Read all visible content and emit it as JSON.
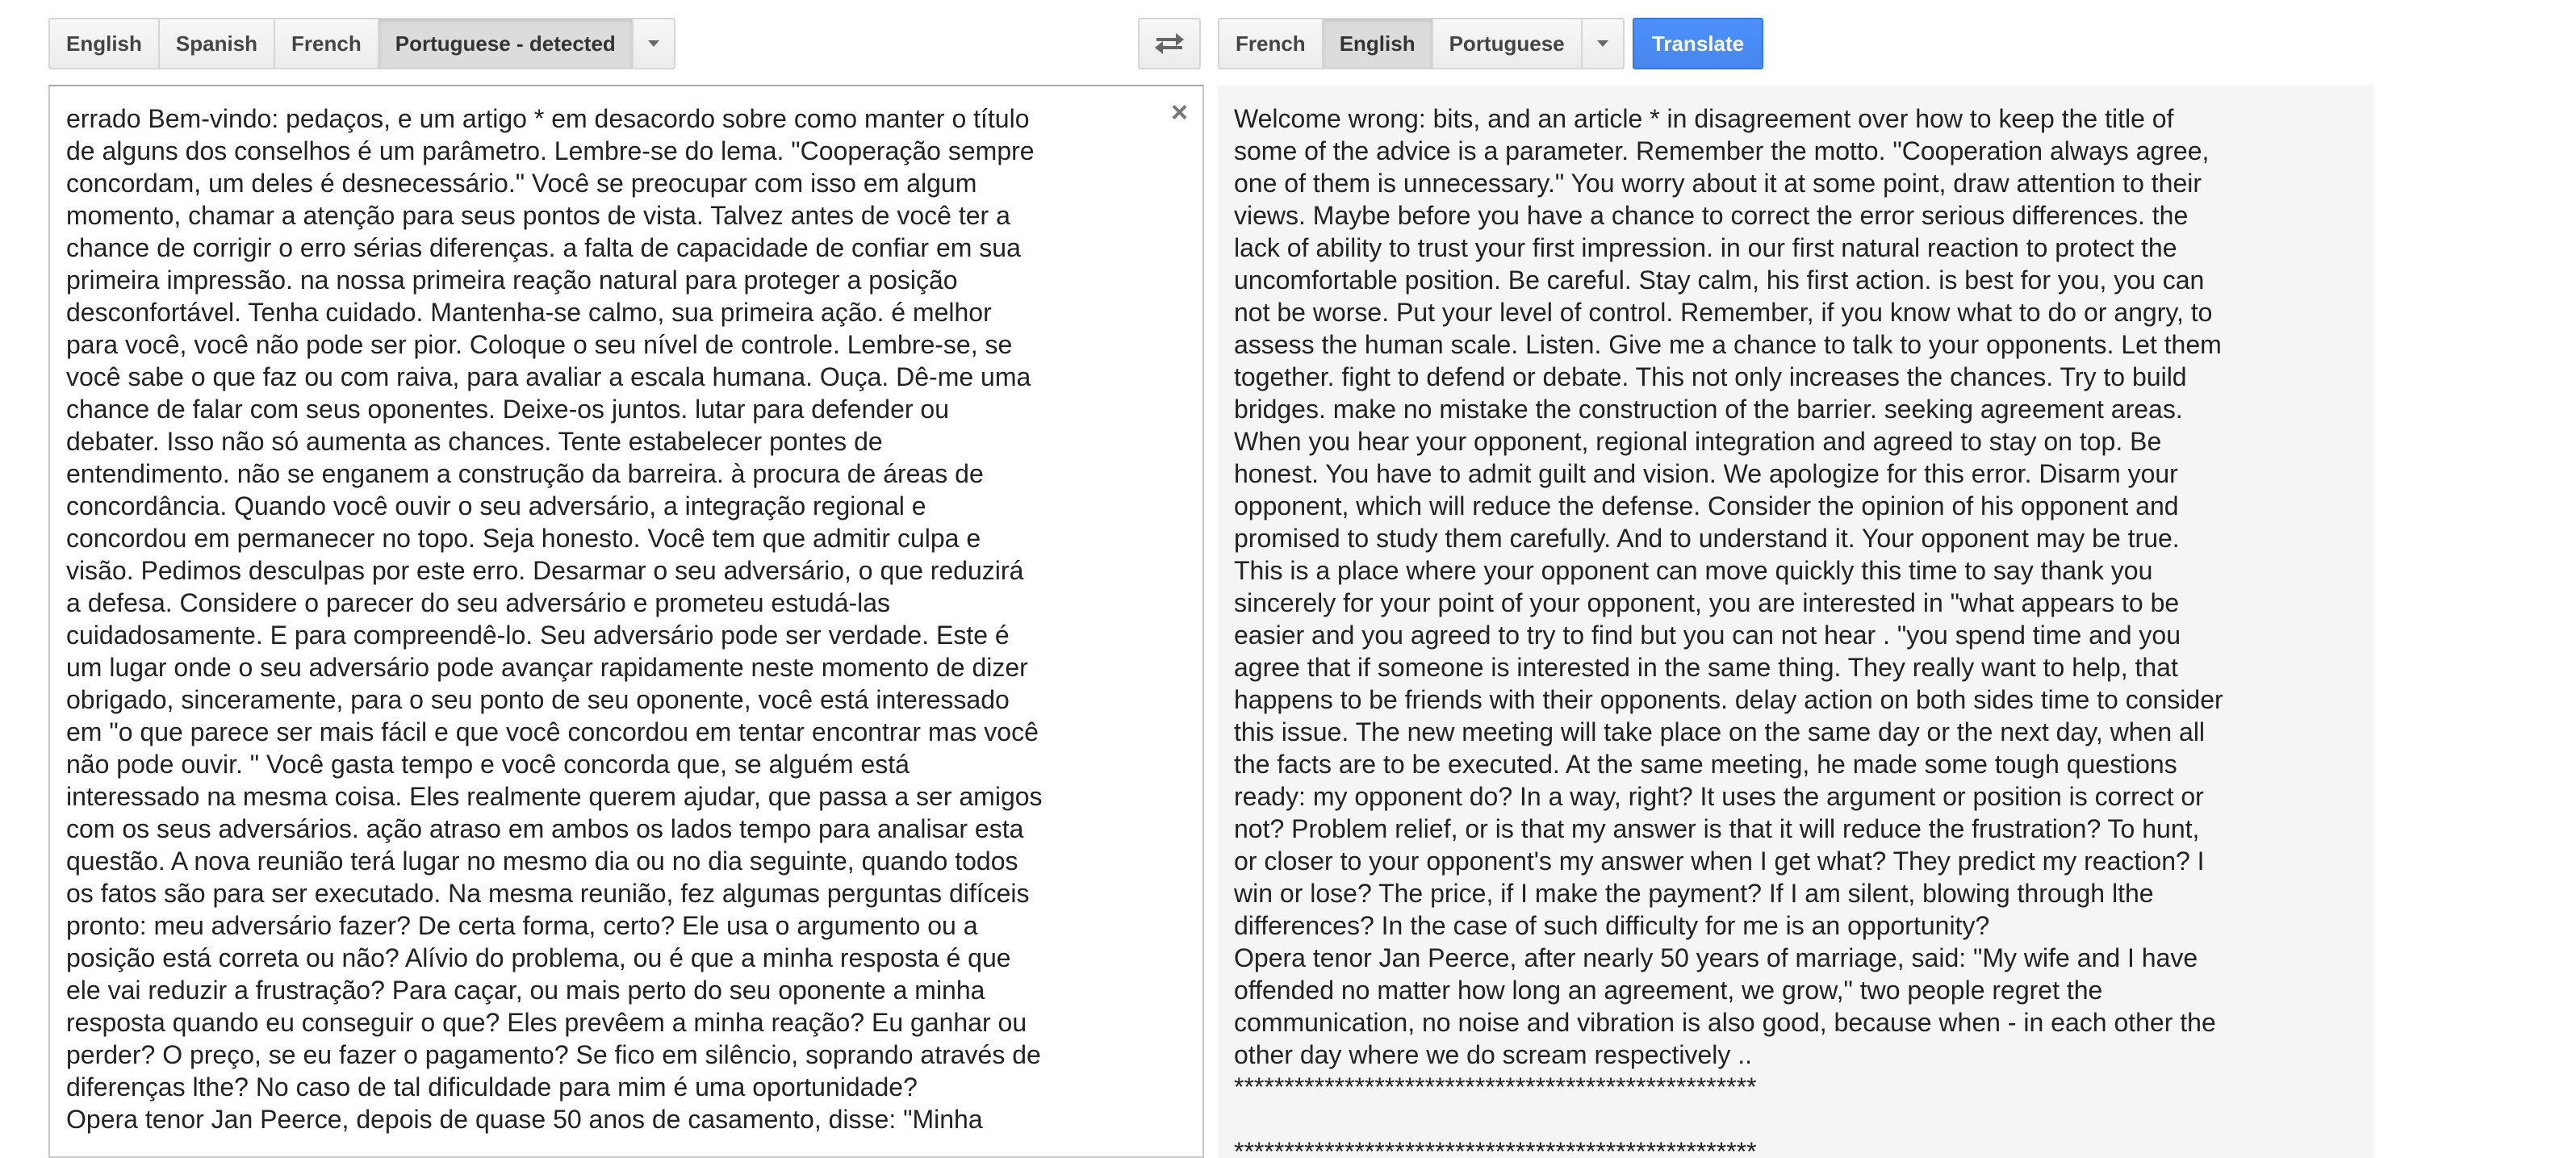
{
  "source_languages": {
    "buttons": [
      "English",
      "Spanish",
      "French",
      "Portuguese - detected"
    ],
    "selected_index": 3
  },
  "target_languages": {
    "buttons": [
      "French",
      "English",
      "Portuguese"
    ],
    "selected_index": 1
  },
  "icons": {
    "swap": "swap-languages-icon",
    "dropdown": "chevron-down-icon",
    "clear": "close-icon"
  },
  "translate_button": {
    "label": "Translate",
    "color": "#4d90fe"
  },
  "clear_glyph": "×",
  "source_text": "errado Bem-vindo: pedaços, e um artigo * em desacordo sobre como manter o título\nde alguns dos conselhos é um parâmetro. Lembre-se do lema. \"Cooperação sempre\nconcordam, um deles é desnecessário.\" Você se preocupar com isso em algum\nmomento, chamar a atenção para seus pontos de vista. Talvez antes de você ter a\nchance de corrigir o erro sérias diferenças. a falta de capacidade de confiar em sua\nprimeira impressão. na nossa primeira reação natural para proteger a posição\ndesconfortável. Tenha cuidado. Mantenha-se calmo, sua primeira ação. é melhor\npara você, você não pode ser pior. Coloque o seu nível de controle. Lembre-se, se\nvocê sabe o que faz ou com raiva, para avaliar a escala humana. Ouça. Dê-me uma\nchance de falar com seus oponentes. Deixe-os juntos. lutar para defender ou\ndebater. Isso não só aumenta as chances. Tente estabelecer pontes de\nentendimento. não se enganem a construção da barreira. à procura de áreas de\nconcordância. Quando você ouvir o seu adversário, a integração regional e\nconcordou em permanecer no topo. Seja honesto. Você tem que admitir culpa e\nvisão. Pedimos desculpas por este erro. Desarmar o seu adversário, o que reduzirá\na defesa. Considere o parecer do seu adversário e prometeu estudá-las\ncuidadosamente. E para compreendê-lo. Seu adversário pode ser verdade. Este é\num lugar onde o seu adversário pode avançar rapidamente neste momento de dizer\nobrigado, sinceramente, para o seu ponto de seu oponente, você está interessado\nem \"o que parece ser mais fácil e que você concordou em tentar encontrar mas você\nnão pode ouvir. \" Você gasta tempo e você concorda que, se alguém está\ninteressado na mesma coisa. Eles realmente querem ajudar, que passa a ser amigos\ncom os seus adversários. ação atraso em ambos os lados tempo para analisar esta\nquestão. A nova reunião terá lugar no mesmo dia ou no dia seguinte, quando todos\nos fatos são para ser executado. Na mesma reunião, fez algumas perguntas difíceis\npronto: meu adversário fazer? De certa forma, certo? Ele usa o argumento ou a\nposição está correta ou não? Alívio do problema, ou é que a minha resposta é que\nele vai reduzir a frustração? Para caçar, ou mais perto do seu oponente a minha\nresposta quando eu conseguir o que? Eles prevêem a minha reação? Eu ganhar ou\nperder? O preço, se eu fazer o pagamento? Se fico em silêncio, soprando através de\ndiferenças lthe? No caso de tal dificuldade para mim é uma oportunidade?\nOpera tenor Jan Peerce, depois de quase 50 anos de casamento, disse: \"Minha",
  "translated_text": "Welcome wrong: bits, and an article * in disagreement over how to keep the title of\nsome of the advice is a parameter. Remember the motto. \"Cooperation always agree,\none of them is unnecessary.\" You worry about it at some point, draw attention to their\nviews. Maybe before you have a chance to correct the error serious differences. the\nlack of ability to trust your first impression. in our first natural reaction to protect the\nuncomfortable position. Be careful. Stay calm, his first action. is best for you, you can\nnot be worse. Put your level of control. Remember, if you know what to do or angry, to\nassess the human scale. Listen. Give me a chance to talk to your opponents. Let them\ntogether. fight to defend or debate. This not only increases the chances. Try to build\nbridges. make no mistake the construction of the barrier. seeking agreement areas.\nWhen you hear your opponent, regional integration and agreed to stay on top. Be\nhonest. You have to admit guilt and vision. We apologize for this error. Disarm your\nopponent, which will reduce the defense. Consider the opinion of his opponent and\npromised to study them carefully. And to understand it. Your opponent may be true.\nThis is a place where your opponent can move quickly this time to say thank you\nsincerely for your point of your opponent, you are interested in \"what appears to be\neasier and you agreed to try to find but you can not hear . \"you spend time and you\nagree that if someone is interested in the same thing. They really want to help, that\nhappens to be friends with their opponents. delay action on both sides time to consider\nthis issue. The new meeting will take place on the same day or the next day, when all\nthe facts are to be executed. At the same meeting, he made some tough questions\nready: my opponent do? In a way, right? It uses the argument or position is correct or\nnot? Problem relief, or is that my answer is that it will reduce the frustration? To hunt,\nor closer to your opponent's my answer when I get what? They predict my reaction? I\nwin or lose? The price, if I make the payment? If I am silent, blowing through lthe\ndifferences? In the case of such difficulty for me is an opportunity?\nOpera tenor Jan Peerce, after nearly 50 years of marriage, said: \"My wife and I have\noffended no matter how long an agreement, we grow,\" two people regret the\ncommunication, no noise and vibration is also good, because when - in each other the\nother day where we do scream respectively ..\n****************************************************\n\n****************************************************"
}
